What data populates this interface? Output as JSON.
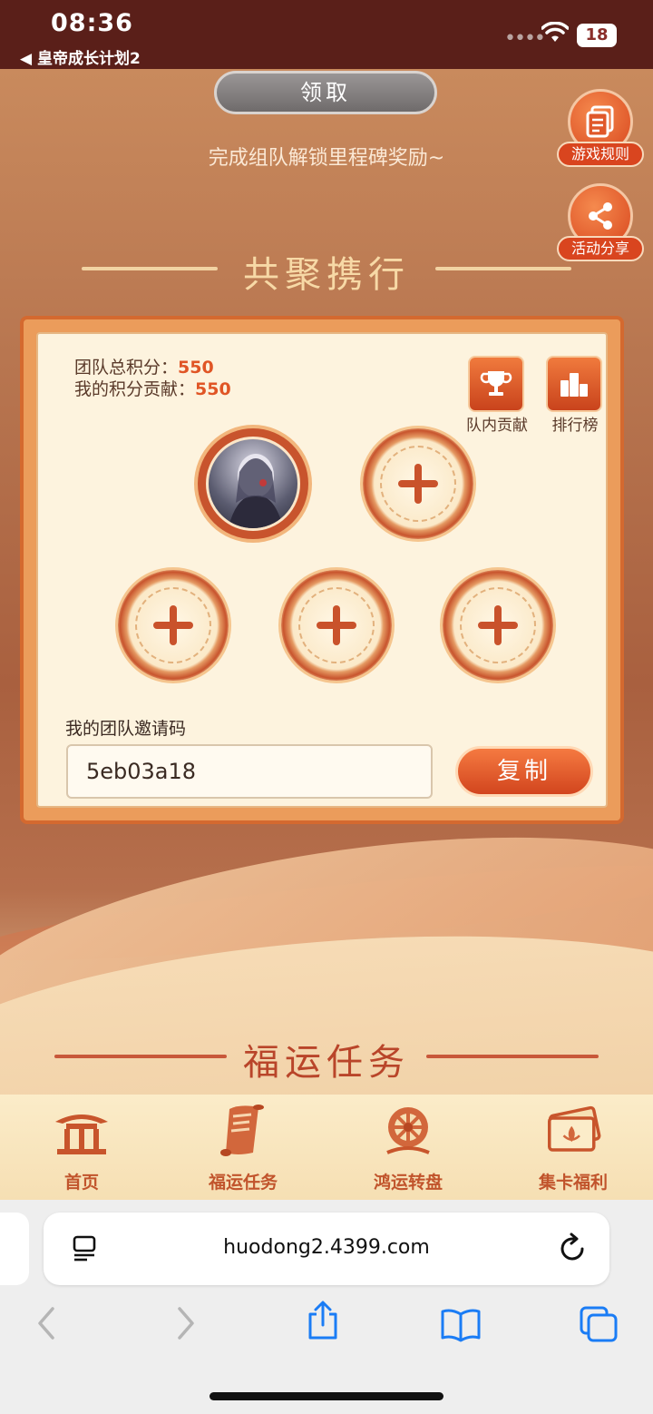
{
  "status_bar": {
    "time": "08:36",
    "back_app": "◀ 皇帝成长计划2",
    "battery": "18"
  },
  "header": {
    "claim_button": "领取",
    "subtitle": "完成组队解锁里程碑奖励~"
  },
  "side_buttons": {
    "rules": "游戏规则",
    "share": "活动分享"
  },
  "team_section": {
    "title": "共聚携行",
    "team_score_label": "团队总积分：",
    "team_score_value": "550",
    "my_score_label": "我的积分贡献：",
    "my_score_value": "550",
    "contribution_button": "队内贡献",
    "ranking_button": "排行榜",
    "invite_label": "我的团队邀请码",
    "invite_code": "5eb03a18",
    "copy_button": "复制"
  },
  "task_section": {
    "title": "福运任务"
  },
  "tabs": [
    {
      "label": "首页"
    },
    {
      "label": "福运任务"
    },
    {
      "label": "鸿运转盘"
    },
    {
      "label": "集卡福利"
    }
  ],
  "browser": {
    "url": "huodong2.4399.com"
  },
  "colors": {
    "accent": "#d9481f",
    "score": "#e05525",
    "tab_text": "#c1542c",
    "ios_blue": "#1a7cf5"
  }
}
